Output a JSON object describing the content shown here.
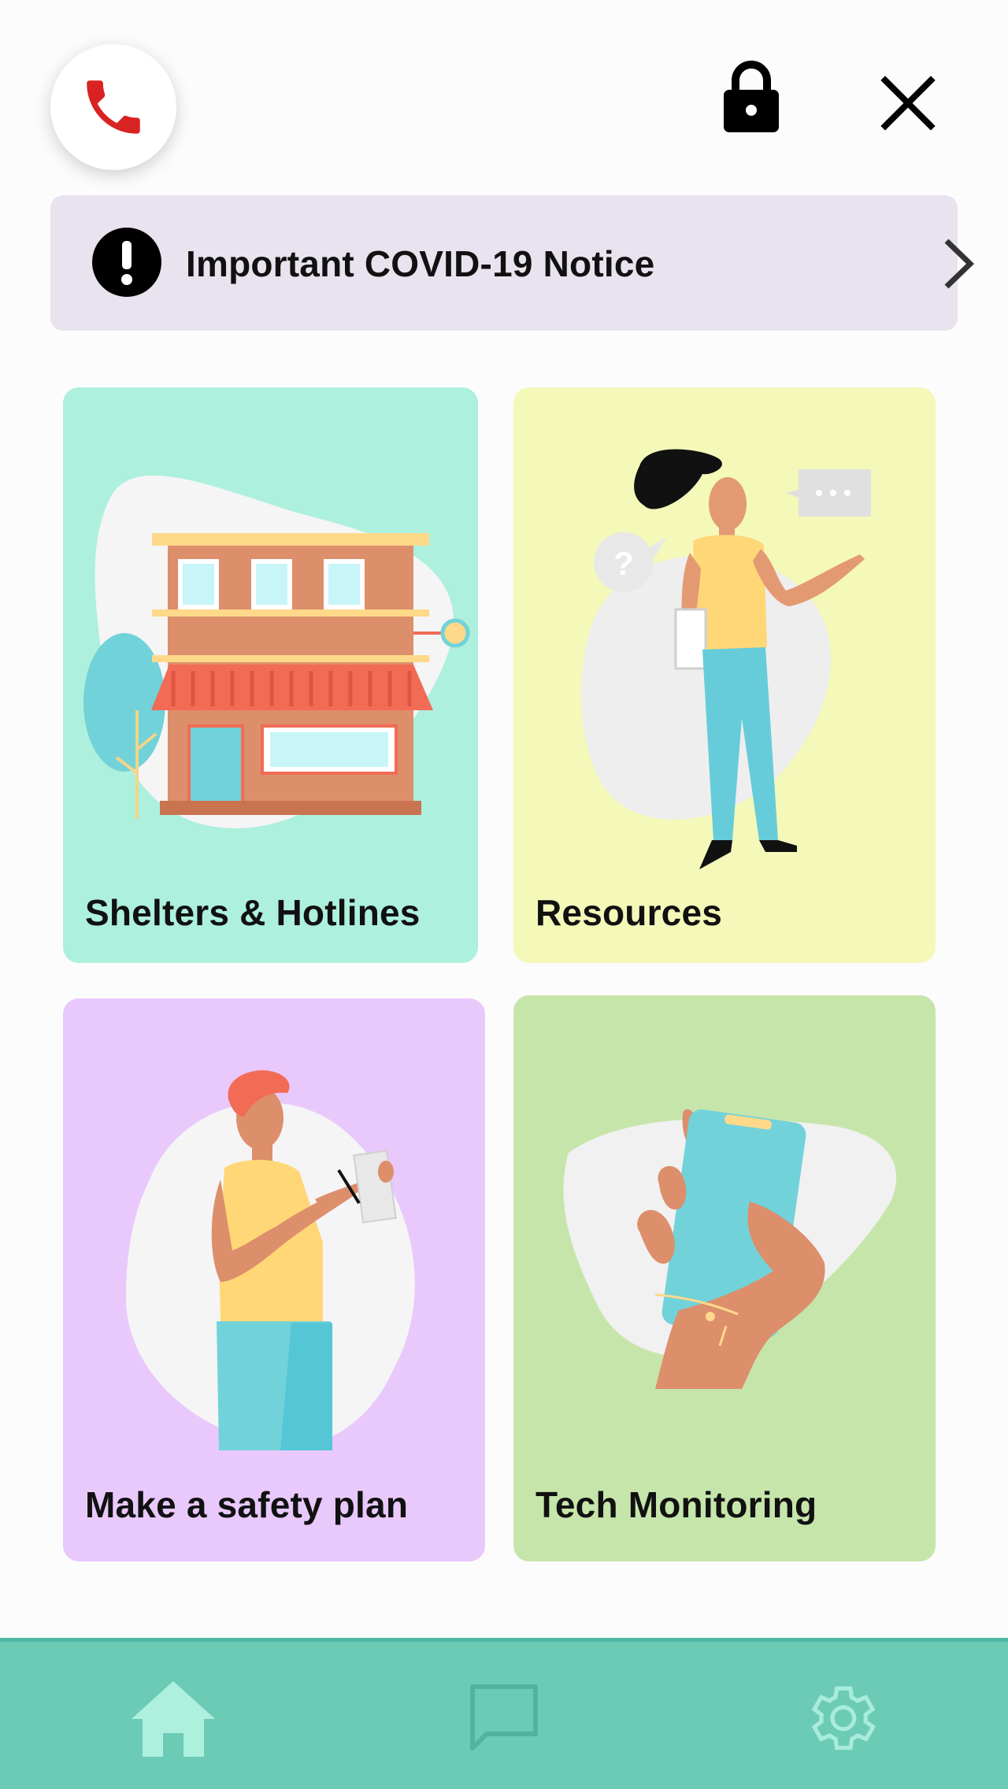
{
  "header": {
    "call_icon": "phone-icon",
    "lock_icon": "lock-icon",
    "close_icon": "close-icon"
  },
  "notice": {
    "icon": "exclamation-icon",
    "label": "Important COVID-19 Notice",
    "chevron": "chevron-right-icon"
  },
  "cards": [
    {
      "title": "Shelters & Hotlines",
      "color": "#adf0dd",
      "illustration": "building-illustration"
    },
    {
      "title": "Resources",
      "color": "#f4f8b9",
      "illustration": "woman-talking-illustration"
    },
    {
      "title": "Make a safety plan",
      "color": "#e9c9fb",
      "illustration": "person-writing-illustration"
    },
    {
      "title": "Tech Monitoring",
      "color": "#c6e5ab",
      "illustration": "hand-phone-illustration"
    }
  ],
  "bottom_nav": {
    "items": [
      {
        "icon": "home-icon",
        "active": true
      },
      {
        "icon": "chat-icon",
        "active": false
      },
      {
        "icon": "gear-icon",
        "active": false
      }
    ],
    "bar_color": "#6bcbb4",
    "active_color": "#adf0dd"
  },
  "colors": {
    "call_red": "#d92323",
    "notice_bg": "#e8e3ee"
  }
}
